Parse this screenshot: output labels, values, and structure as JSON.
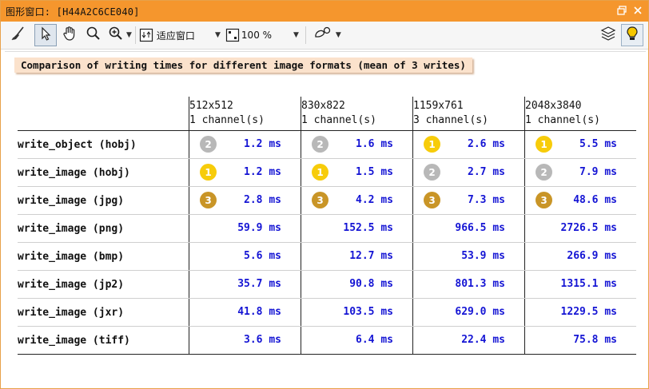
{
  "window": {
    "title": "图形窗口: [H44A2C6CE040]"
  },
  "toolbar": {
    "fit_label": "适应窗口",
    "zoom_label": "100 %"
  },
  "heading": "Comparison of writing times for different image formats (mean of 3 writes)",
  "table": {
    "columns": [
      {
        "size": "512x512",
        "channels": "1 channel(s)"
      },
      {
        "size": "830x822",
        "channels": "1 channel(s)"
      },
      {
        "size": "1159x761",
        "channels": "3 channel(s)"
      },
      {
        "size": "2048x3840",
        "channels": "1 channel(s)"
      }
    ],
    "rows": [
      {
        "label": "write_object (hobj)",
        "cells": [
          {
            "medal": "2",
            "value": "1.2 ms"
          },
          {
            "medal": "2",
            "value": "1.6 ms"
          },
          {
            "medal": "1",
            "value": "2.6 ms"
          },
          {
            "medal": "1",
            "value": "5.5 ms"
          }
        ]
      },
      {
        "label": "write_image (hobj)",
        "cells": [
          {
            "medal": "1",
            "value": "1.2 ms"
          },
          {
            "medal": "1",
            "value": "1.5 ms"
          },
          {
            "medal": "2",
            "value": "2.7 ms"
          },
          {
            "medal": "2",
            "value": "7.9 ms"
          }
        ]
      },
      {
        "label": "write_image (jpg)",
        "cells": [
          {
            "medal": "3",
            "value": "2.8 ms"
          },
          {
            "medal": "3",
            "value": "4.2 ms"
          },
          {
            "medal": "3",
            "value": "7.3 ms"
          },
          {
            "medal": "3",
            "value": "48.6 ms"
          }
        ]
      },
      {
        "label": "write_image (png)",
        "cells": [
          {
            "medal": "",
            "value": "59.9 ms"
          },
          {
            "medal": "",
            "value": "152.5 ms"
          },
          {
            "medal": "",
            "value": "966.5 ms"
          },
          {
            "medal": "",
            "value": "2726.5 ms"
          }
        ]
      },
      {
        "label": "write_image (bmp)",
        "cells": [
          {
            "medal": "",
            "value": "5.6 ms"
          },
          {
            "medal": "",
            "value": "12.7 ms"
          },
          {
            "medal": "",
            "value": "53.9 ms"
          },
          {
            "medal": "",
            "value": "266.9 ms"
          }
        ]
      },
      {
        "label": "write_image (jp2)",
        "cells": [
          {
            "medal": "",
            "value": "35.7 ms"
          },
          {
            "medal": "",
            "value": "90.8 ms"
          },
          {
            "medal": "",
            "value": "801.3 ms"
          },
          {
            "medal": "",
            "value": "1315.1 ms"
          }
        ]
      },
      {
        "label": "write_image (jxr)",
        "cells": [
          {
            "medal": "",
            "value": "41.8 ms"
          },
          {
            "medal": "",
            "value": "103.5 ms"
          },
          {
            "medal": "",
            "value": "629.0 ms"
          },
          {
            "medal": "",
            "value": "1229.5 ms"
          }
        ]
      },
      {
        "label": "write_image (tiff)",
        "cells": [
          {
            "medal": "",
            "value": "3.6 ms"
          },
          {
            "medal": "",
            "value": "6.4 ms"
          },
          {
            "medal": "",
            "value": "22.4 ms"
          },
          {
            "medal": "",
            "value": "75.8 ms"
          }
        ]
      }
    ]
  },
  "colors": {
    "titlebar": "#f5962d",
    "value_text": "#1414d4",
    "gold": "#f7cc0a",
    "silver": "#b8b8b8",
    "bronze": "#c99527",
    "heading_bg": "#fbe2cc"
  },
  "icons": [
    "broom-icon",
    "pointer-icon",
    "hand-icon",
    "magnifier-icon",
    "zoom-in-icon",
    "fit-window-icon",
    "zoom-percent-icon",
    "shape-draw-icon",
    "layers-icon",
    "lightbulb-icon",
    "restore-icon",
    "close-icon"
  ]
}
